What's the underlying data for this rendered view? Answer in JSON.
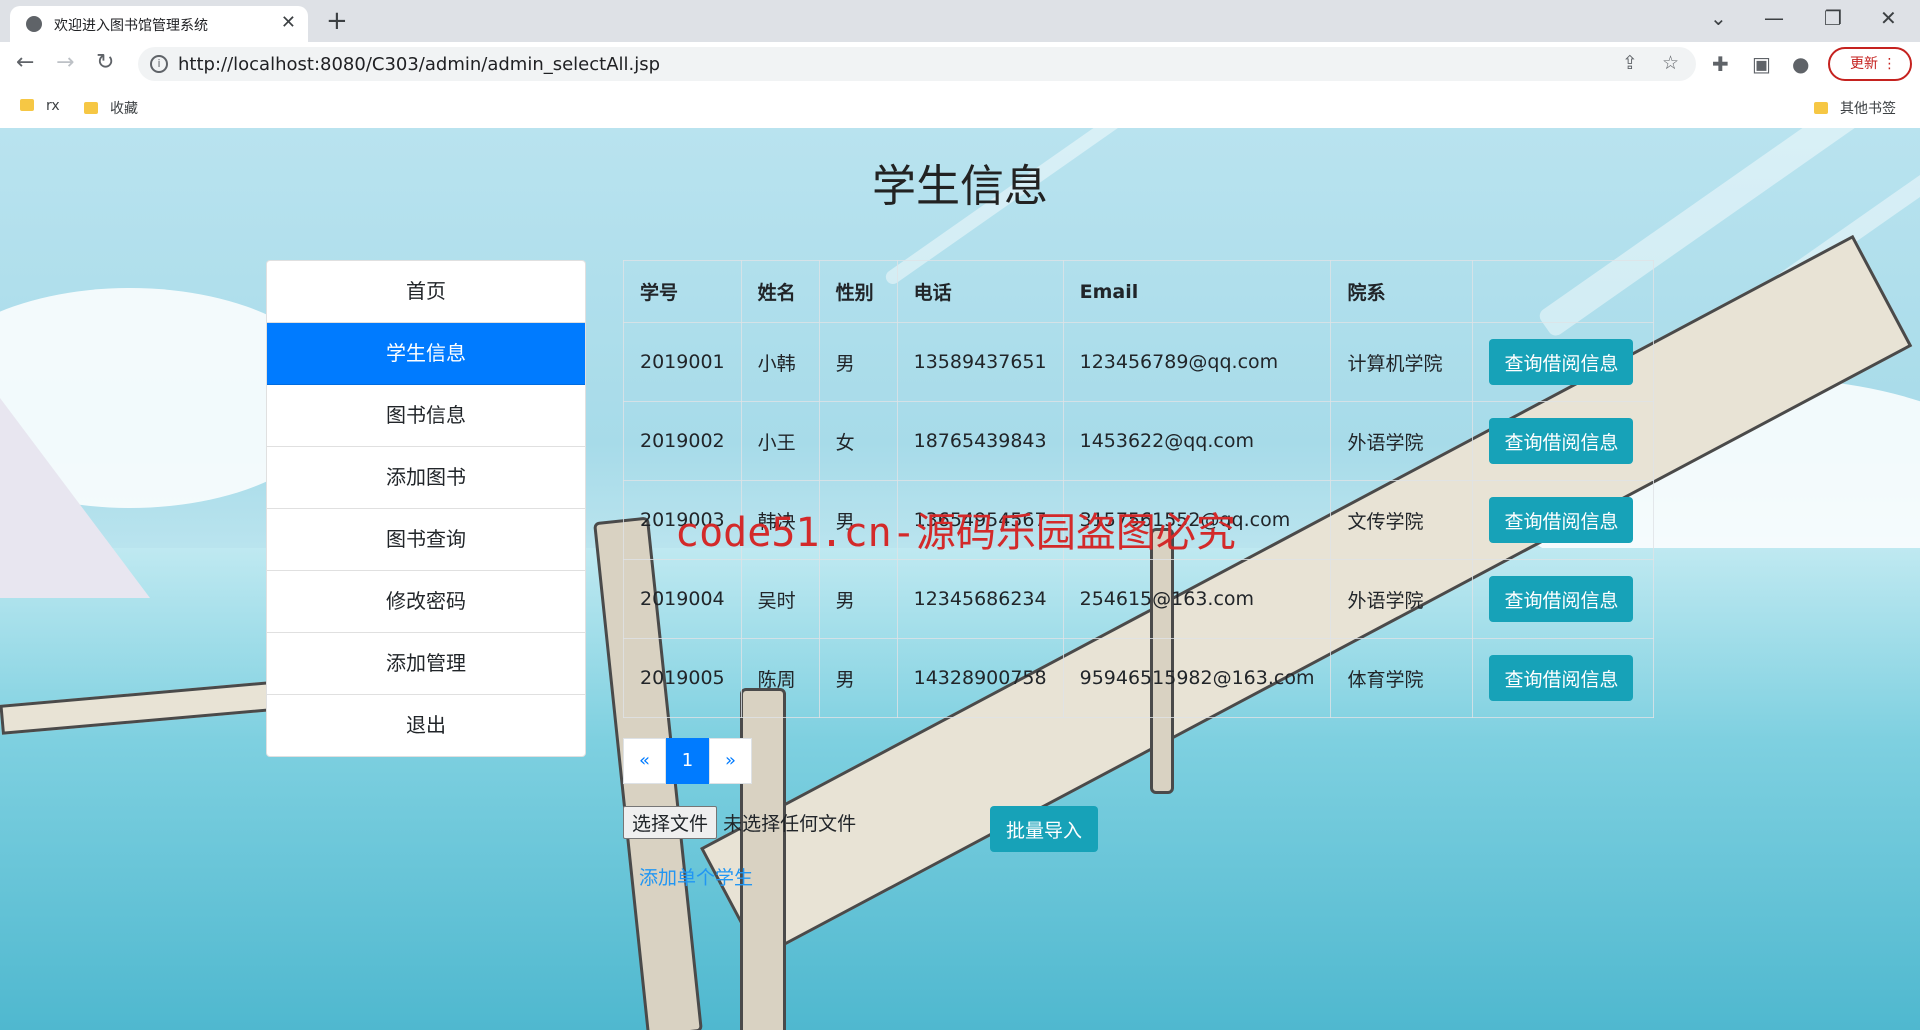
{
  "browser": {
    "tab_title": "欢迎进入图书馆管理系统",
    "url": "http://localhost:8080/C303/admin/admin_selectAll.jsp",
    "update_label": "更新",
    "bookmarks": [
      "rx",
      "收藏"
    ],
    "other_bookmarks": "其他书签"
  },
  "page": {
    "title": "学生信息",
    "sidebar": [
      "首页",
      "学生信息",
      "图书信息",
      "添加图书",
      "图书查询",
      "修改密码",
      "添加管理",
      "退出"
    ],
    "table": {
      "headers": [
        "学号",
        "姓名",
        "性别",
        "电话",
        "Email",
        "院系",
        ""
      ],
      "rows": [
        [
          "2019001",
          "小韩",
          "男",
          "13589437651",
          "123456789@qq.com",
          "计算机学院"
        ],
        [
          "2019002",
          "小王",
          "女",
          "18765439843",
          "1453622@qq.com",
          "外语学院"
        ],
        [
          "2019003",
          "韩决",
          "男",
          "13654954567",
          "3157561552@qq.com",
          "文传学院"
        ],
        [
          "2019004",
          "吴时",
          "男",
          "12345686234",
          "254615@163.com",
          "外语学院"
        ],
        [
          "2019005",
          "陈周",
          "男",
          "14328900758",
          "95946515982@163.com",
          "体育学院"
        ]
      ],
      "action_label": "查询借阅信息"
    },
    "pagination": [
      "«",
      "1",
      "»"
    ],
    "file_button": "选择文件",
    "file_status": "未选择任何文件",
    "import_button": "批量导入",
    "add_link": "添加单个学生",
    "watermark": "code51.cn-源码乐园盗图必究"
  }
}
